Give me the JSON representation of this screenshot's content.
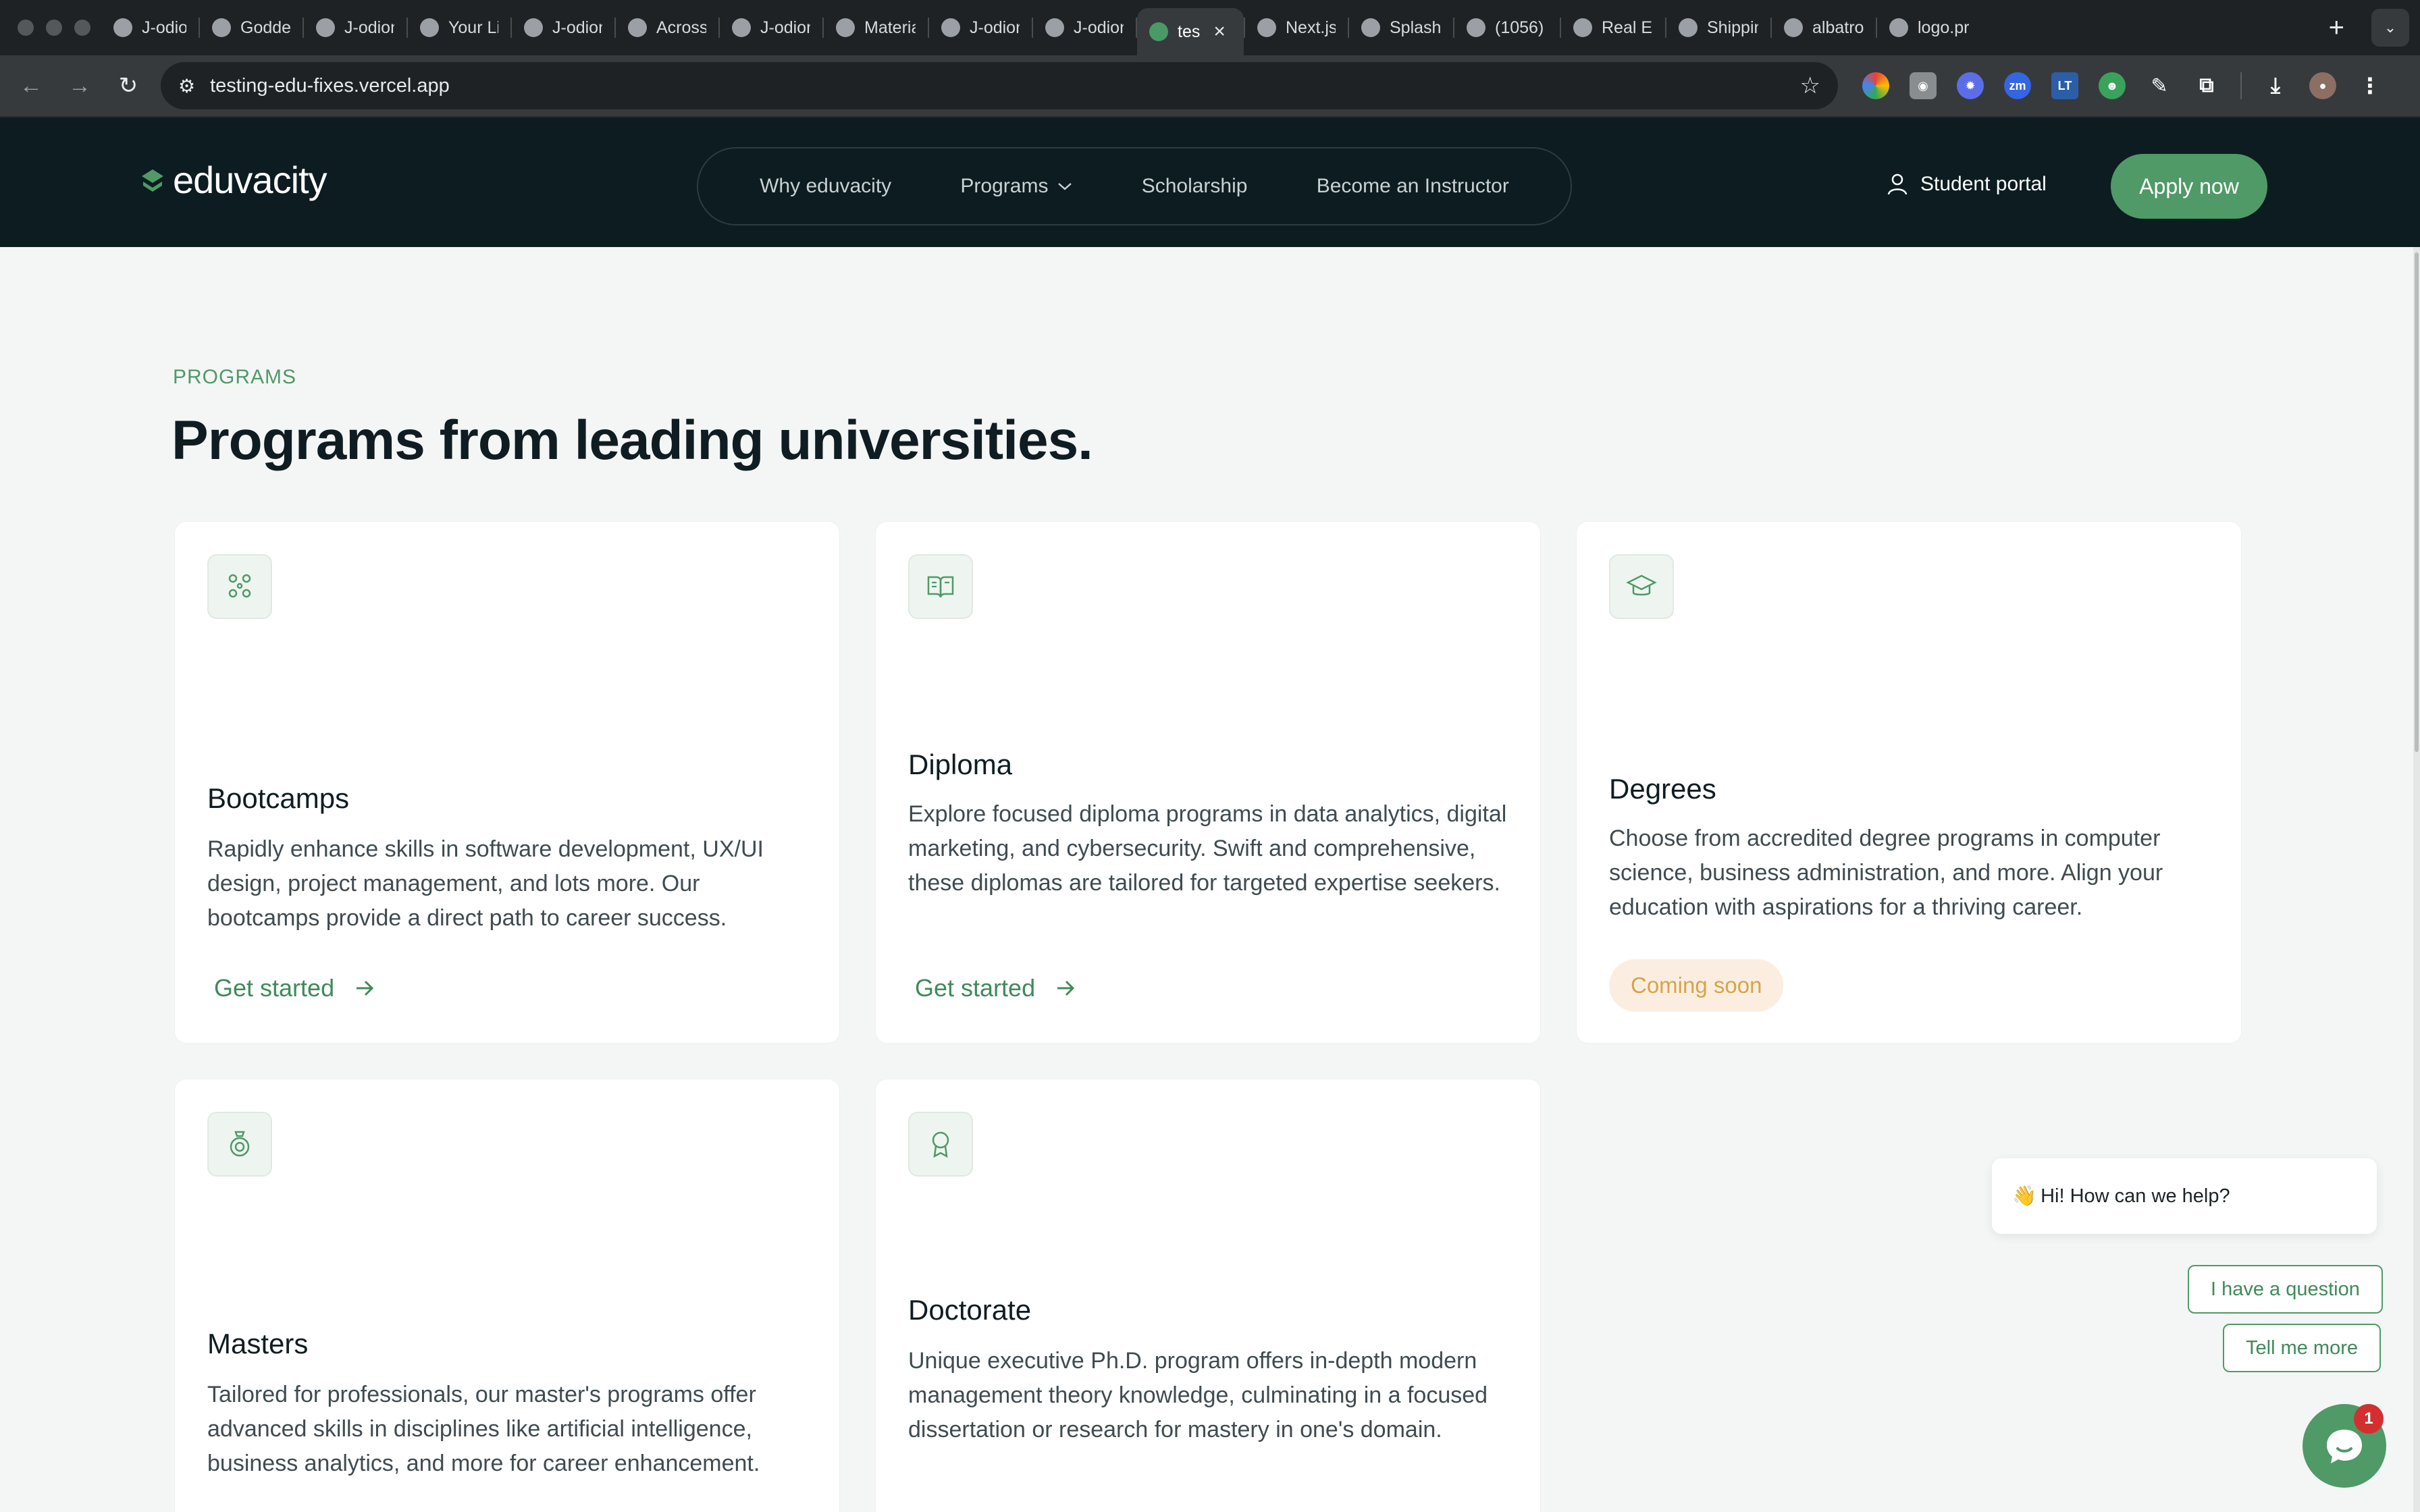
{
  "browser": {
    "tabs": [
      {
        "label": "J-odion",
        "icon": "github-icon"
      },
      {
        "label": "Godde",
        "icon": "globe-icon"
      },
      {
        "label": "J-odion",
        "icon": "github-icon"
      },
      {
        "label": "Your Lig",
        "icon": "globe-icon"
      },
      {
        "label": "J-odion",
        "icon": "github-icon"
      },
      {
        "label": "Across",
        "icon": "globe-icon"
      },
      {
        "label": "J-odion",
        "icon": "github-icon"
      },
      {
        "label": "Materia",
        "icon": "material-icon"
      },
      {
        "label": "J-odion",
        "icon": "github-icon"
      },
      {
        "label": "J-odion",
        "icon": "github-icon"
      },
      {
        "label": "tes",
        "icon": "eduvacity-icon",
        "active": true
      },
      {
        "label": "Next.js",
        "icon": "nextjs-icon"
      },
      {
        "label": "SplashT",
        "icon": "globe-icon"
      },
      {
        "label": "(1056)",
        "icon": "pinterest-icon"
      },
      {
        "label": "Real Es",
        "icon": "behance-icon"
      },
      {
        "label": "Shippin",
        "icon": "dribbble-icon"
      },
      {
        "label": "albatro",
        "icon": "google-icon"
      },
      {
        "label": "logo.pr",
        "icon": "logo-icon"
      }
    ],
    "new_tab": "+",
    "url": "testing-edu-fixes.vercel.app"
  },
  "header": {
    "logo_text": "eduvacity",
    "nav": [
      {
        "label": "Why eduvacity"
      },
      {
        "label": "Programs",
        "dropdown": true
      },
      {
        "label": "Scholarship"
      },
      {
        "label": "Become an Instructor"
      }
    ],
    "portal_label": "Student portal",
    "apply_label": "Apply now"
  },
  "section": {
    "eyebrow": "PROGRAMS",
    "heading": "Programs from leading universities."
  },
  "cards": [
    {
      "title": "Bootcamps",
      "icon": "people-network-icon",
      "description": "Rapidly enhance skills in software development, UX/UI design, project management, and lots more. Our bootcamps provide a direct path to career success.",
      "cta": "Get started"
    },
    {
      "title": "Diploma",
      "icon": "open-book-icon",
      "description": "Explore focused diploma programs in data analytics, digital marketing, and cybersecurity. Swift and comprehensive, these diplomas are tailored for targeted expertise seekers.",
      "cta": "Get started"
    },
    {
      "title": "Degrees",
      "icon": "graduation-cap-icon",
      "description": "Choose from accredited degree programs in computer science, business administration, and more. Align your education with aspirations for a thriving career.",
      "badge": "Coming soon"
    },
    {
      "title": "Masters",
      "icon": "medal-icon",
      "description": "Tailored for professionals, our master's programs offer advanced skills in disciplines like artificial intelligence, business analytics, and more for career enhancement."
    },
    {
      "title": "Doctorate",
      "icon": "award-ribbon-icon",
      "description": "Unique executive Ph.D. program offers in-depth modern management theory knowledge, culminating in a focused dissertation or research for mastery in one's domain."
    }
  ],
  "chat": {
    "greeting_emoji": "👋",
    "greeting": "Hi! How can we help?",
    "quick_replies": [
      "I have a question",
      "Tell me more"
    ],
    "unread_count": "1"
  },
  "colors": {
    "brand_dark": "#0c1c21",
    "brand_green": "#4f9a67",
    "badge_bg": "#fbeee0",
    "badge_text": "#d7a44a"
  }
}
